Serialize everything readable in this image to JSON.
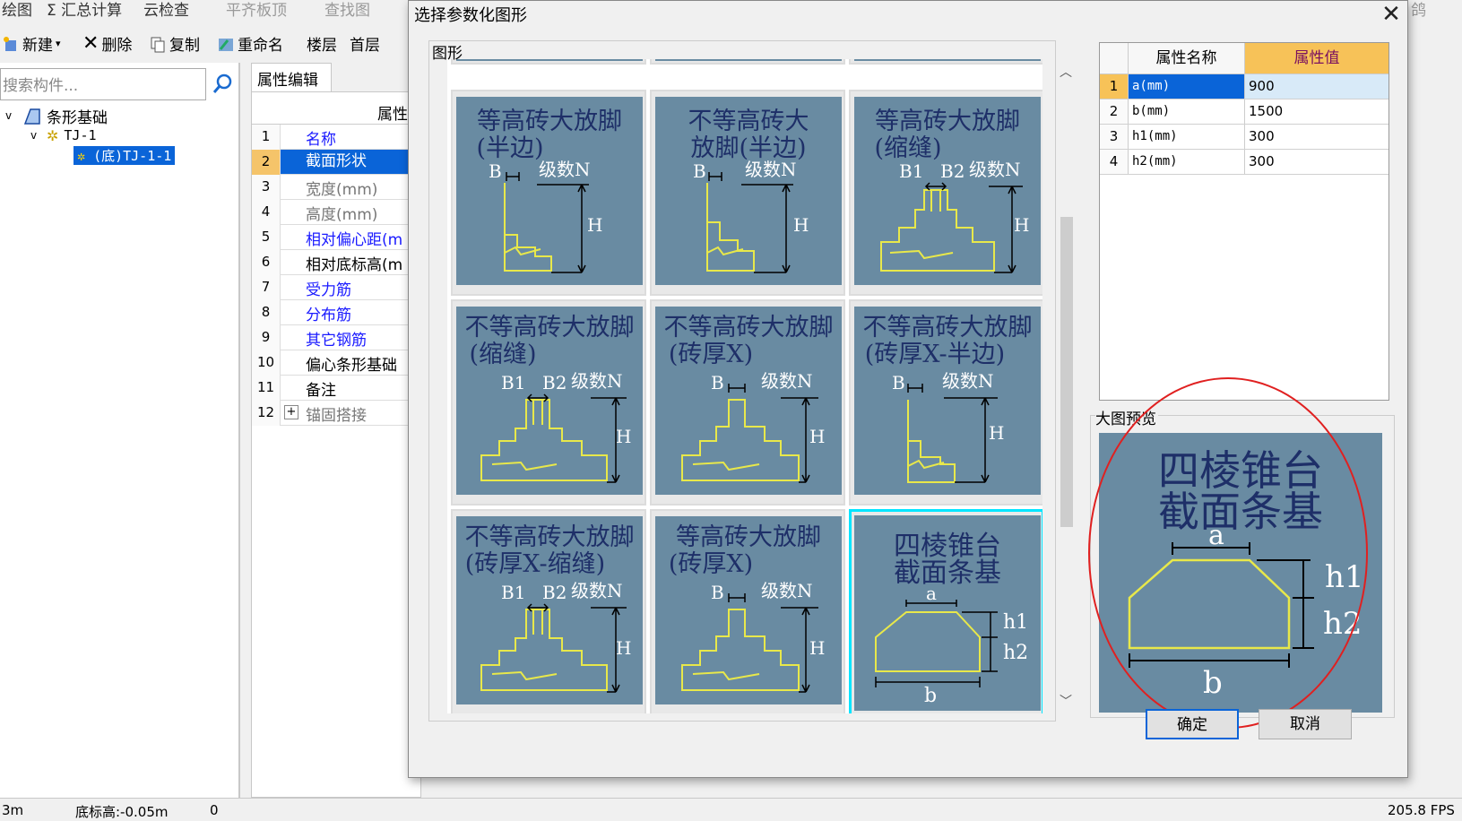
{
  "app": {
    "menubar": [
      "绘图",
      "Σ 汇总计算",
      "云检查",
      "平齐板顶",
      "查找图"
    ],
    "menubar_right": "鸽",
    "toolbar": [
      "新建",
      "删除",
      "复制",
      "重命名",
      "楼层",
      "首层"
    ],
    "search_placeholder": "搜索构件...",
    "tree": [
      "条形基础",
      "TJ-1",
      "(底)TJ-1-1"
    ],
    "prop_tab": "属性编辑",
    "prop_header": "属性",
    "props": [
      {
        "num": "1",
        "name": "名称"
      },
      {
        "num": "2",
        "name": "截面形状"
      },
      {
        "num": "3",
        "name": "宽度(mm)"
      },
      {
        "num": "4",
        "name": "高度(mm)"
      },
      {
        "num": "5",
        "name": "相对偏心距(m"
      },
      {
        "num": "6",
        "name": "相对底标高(m"
      },
      {
        "num": "7",
        "name": "受力筋"
      },
      {
        "num": "8",
        "name": "分布筋"
      },
      {
        "num": "9",
        "name": "其它钢筋"
      },
      {
        "num": "10",
        "name": "偏心条形基础"
      },
      {
        "num": "11",
        "name": "备注"
      },
      {
        "num": "12",
        "name": "锚固搭接"
      }
    ],
    "status": [
      "3m",
      "底标高:-0.05m",
      "0",
      "205.8 FPS"
    ]
  },
  "dialog": {
    "title": "选择参数化图形",
    "close": "✕",
    "gallery_label": "图形",
    "shapes": [
      {
        "line1": "等高砖大放脚",
        "line2": "(半边)"
      },
      {
        "line1": "不等高砖大",
        "line2": "放脚(半边)"
      },
      {
        "line1": "等高砖大放脚",
        "line2": "(缩缝)"
      },
      {
        "line1": "不等高砖大放脚",
        "line2": "(缩缝)"
      },
      {
        "line1": "不等高砖大放脚",
        "line2": "(砖厚X)"
      },
      {
        "line1": "不等高砖大放脚",
        "line2": "(砖厚X-半边)"
      },
      {
        "line1": "不等高砖大放脚",
        "line2": "(砖厚X-缩缝)"
      },
      {
        "line1": "等高砖大放脚",
        "line2": "(砖厚X)"
      },
      {
        "line1": "四棱锥台",
        "line2": "截面条基"
      }
    ],
    "tile_labels": {
      "B": "B",
      "B1": "B1",
      "B2": "B2",
      "N": "级数N",
      "H": "H",
      "a": "a",
      "b": "b",
      "h1": "h1",
      "h2": "h2"
    },
    "attr_header": [
      "属性名称",
      "属性值"
    ],
    "attrs": [
      {
        "num": "1",
        "name": "a(mm)",
        "value": "900"
      },
      {
        "num": "2",
        "name": "b(mm)",
        "value": "1500"
      },
      {
        "num": "3",
        "name": "h1(mm)",
        "value": "300"
      },
      {
        "num": "4",
        "name": "h2(mm)",
        "value": "300"
      }
    ],
    "preview_label": "大图预览",
    "ok": "确定",
    "cancel": "取消"
  },
  "colors": {
    "tile_bg": "#698ba2",
    "tile_line": "#e8e84a",
    "selection": "#0a64d8",
    "highlight_border": "#00e5ff",
    "annotation": "#e02020"
  }
}
